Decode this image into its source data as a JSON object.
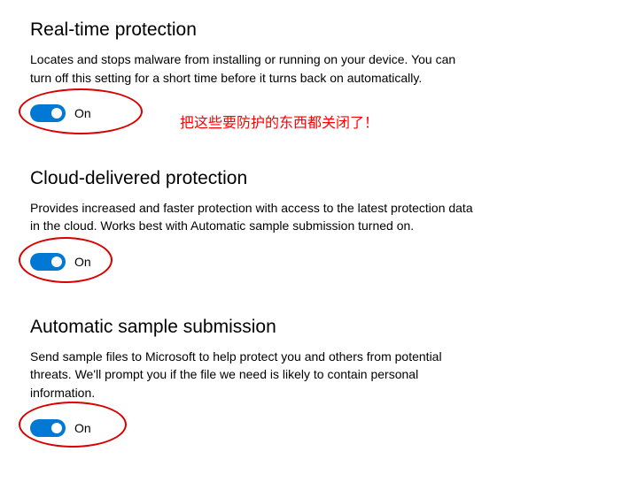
{
  "sections": {
    "realtime": {
      "title": "Real-time protection",
      "description": "Locates and stops malware from installing or running on your device. You can turn off this setting for a short time before it turns back on automatically.",
      "toggle_label": "On"
    },
    "cloud": {
      "title": "Cloud-delivered protection",
      "description": "Provides increased and faster protection with access to the latest protection data in the cloud. Works best with Automatic sample submission turned on.",
      "toggle_label": "On"
    },
    "sample": {
      "title": "Automatic sample submission",
      "description": "Send sample files to Microsoft to help protect you and others from potential threats. We'll prompt you if the file we need is likely to contain personal information.",
      "toggle_label": "On"
    }
  },
  "annotations": {
    "text1": "把这些要防护的东西都关闭了！"
  },
  "colors": {
    "toggle_on": "#0078d4",
    "annotation": "#d90000"
  }
}
